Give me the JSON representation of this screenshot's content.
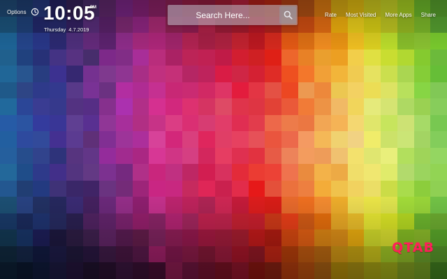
{
  "topbar": {
    "options_label": "Options",
    "clock_icon": "clock-icon"
  },
  "clock": {
    "time": "10:05",
    "ampm": "PM",
    "weekday": "Thursday",
    "date": "4.7.2019"
  },
  "search": {
    "placeholder": "Search Here...",
    "value": "",
    "button_icon": "search-icon"
  },
  "nav": {
    "items": [
      {
        "label": "Rate"
      },
      {
        "label": "Most Visited"
      },
      {
        "label": "More Apps"
      },
      {
        "label": "Share"
      }
    ]
  },
  "logo": {
    "text": "QTAB",
    "color": "#ff1f5a"
  },
  "wallpaper": {
    "description_colors": [
      "#1e6fa8",
      "#3a3f8f",
      "#7b2f8a",
      "#c72a7a",
      "#e0304f",
      "#f07a3a",
      "#f5d36a",
      "#c9e27a",
      "#6fbf5a"
    ]
  }
}
